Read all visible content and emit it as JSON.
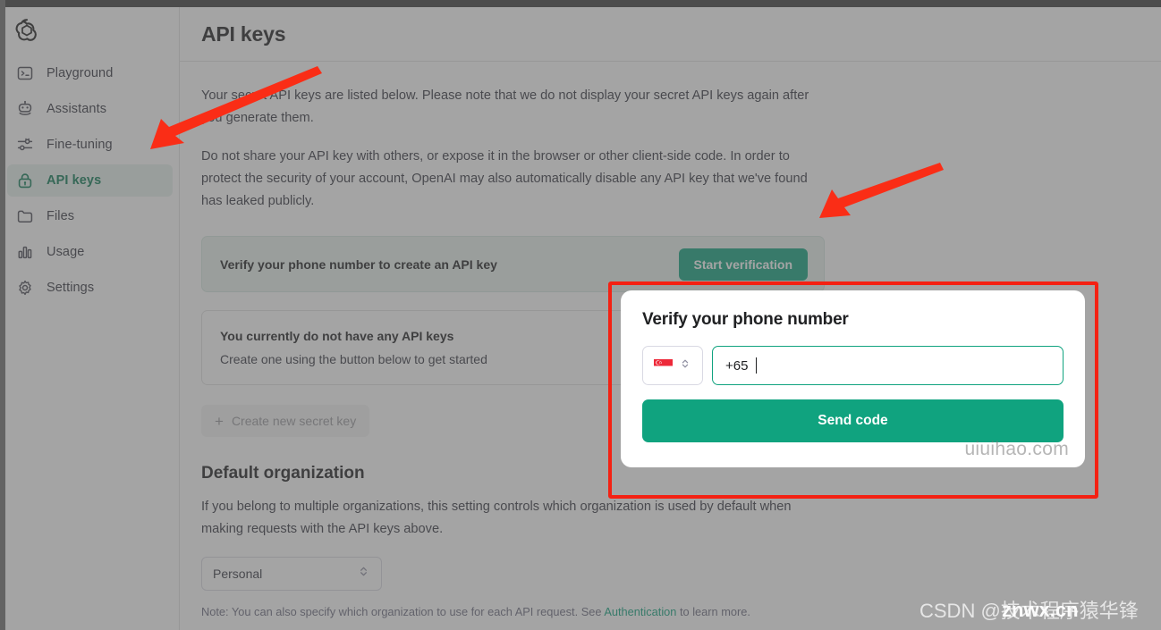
{
  "sidebar": {
    "logo_icon": "openai-logo",
    "items": [
      {
        "label": "Playground",
        "icon": "terminal-icon",
        "active": false
      },
      {
        "label": "Assistants",
        "icon": "robot-icon",
        "active": false
      },
      {
        "label": "Fine-tuning",
        "icon": "sliders-icon",
        "active": false
      },
      {
        "label": "API keys",
        "icon": "lock-icon",
        "active": true
      },
      {
        "label": "Files",
        "icon": "folder-icon",
        "active": false
      },
      {
        "label": "Usage",
        "icon": "chart-bar-icon",
        "active": false
      },
      {
        "label": "Settings",
        "icon": "gear-icon",
        "active": false
      }
    ]
  },
  "header": {
    "title": "API keys"
  },
  "main": {
    "paragraph1": "Your secret API keys are listed below. Please note that we do not display your secret API keys again after you generate them.",
    "paragraph2": "Do not share your API key with others, or expose it in the browser or other client-side code. In order to protect the security of your account, OpenAI may also automatically disable any API key that we've found has leaked publicly.",
    "verify_banner": {
      "text": "Verify your phone number to create an API key",
      "button_label": "Start verification"
    },
    "keys_empty": {
      "title": "You currently do not have any API keys",
      "subtitle": "Create one using the button below to get started"
    },
    "create_key_button": {
      "plus": "+",
      "label": "Create new secret key"
    },
    "default_organization": {
      "title": "Default organization",
      "description": "If you belong to multiple organizations, this setting controls which organization is used by default when making requests with the API keys above.",
      "selected_value": "Personal",
      "note_prefix": "Note: You can also specify which organization to use for each API request. See ",
      "note_link": "Authentication",
      "note_suffix": " to learn more."
    }
  },
  "modal": {
    "title": "Verify your phone number",
    "country_flag": "singapore-flag",
    "phone_value": "+65",
    "send_button_label": "Send code",
    "watermark": "uiuihao.com"
  },
  "annotations": {
    "box_color": "#f42113",
    "arrow_color": "#fa2d16"
  },
  "watermarks": {
    "csdn": "CSDN @技术程序猿华锋",
    "znwx": "znwx.cn"
  },
  "colors": {
    "accent_green": "#10a37f",
    "active_nav_text": "#0d7a55",
    "active_nav_bg": "#e6f1ed",
    "banner_bg": "#e9f2ee"
  }
}
